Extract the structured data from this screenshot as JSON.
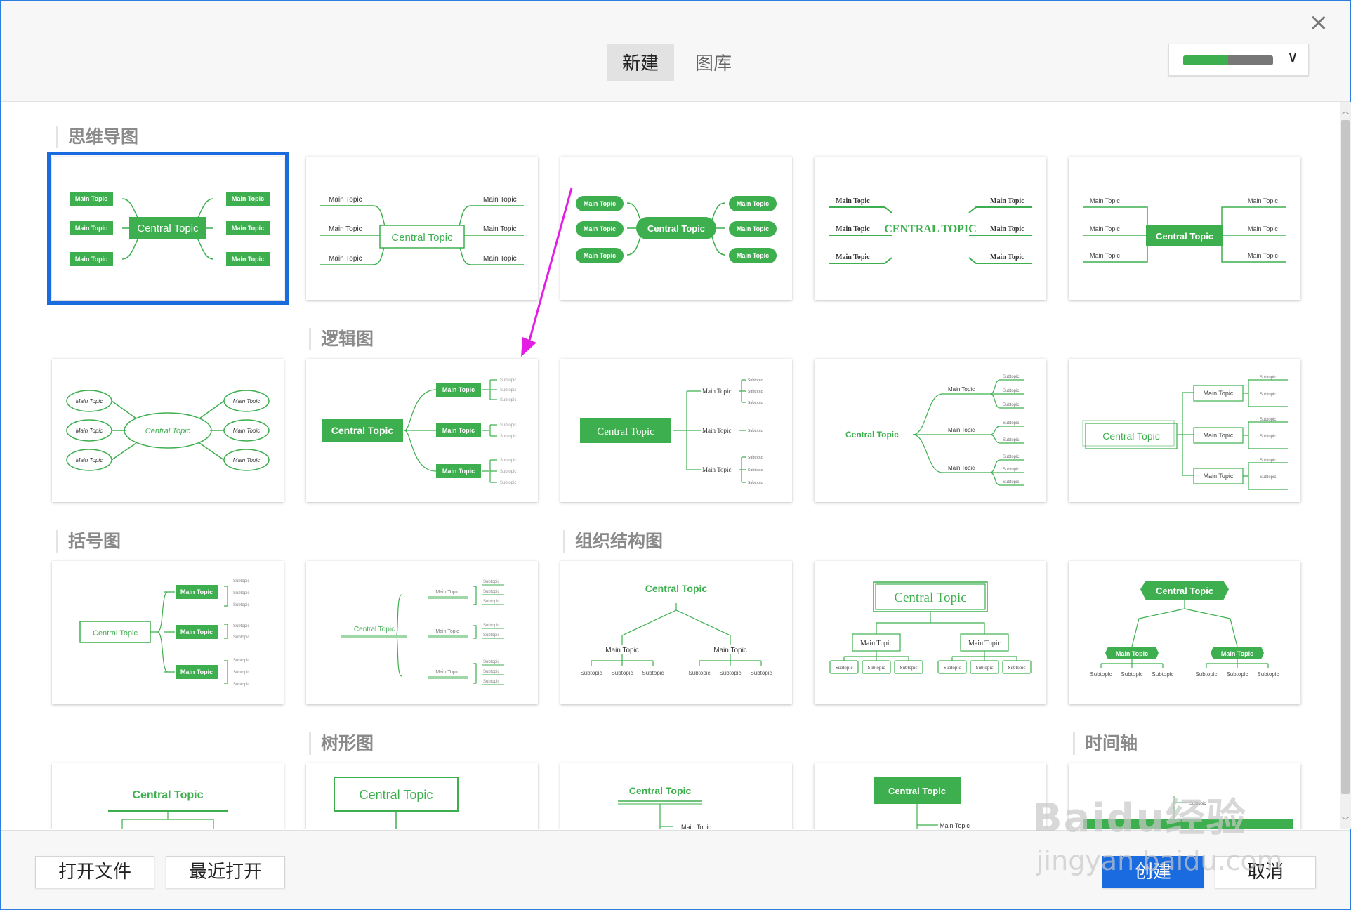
{
  "header": {
    "tabs": [
      {
        "label": "新建",
        "active": true
      },
      {
        "label": "图库",
        "active": false
      }
    ],
    "close_label": "×",
    "theme_chevron": "∨",
    "theme_colors": [
      "#3daf4e",
      "#777777"
    ]
  },
  "sections": {
    "mindmap": "思维导图",
    "logic": "逻辑图",
    "brace": "括号图",
    "org": "组织结构图",
    "tree": "树形图",
    "timeline": "时间轴"
  },
  "labels": {
    "central": "Central Topic",
    "central_caps": "CENTRAL TOPIC",
    "main": "Main Topic",
    "sub": "Subtopic"
  },
  "footer": {
    "open_file": "打开文件",
    "recent": "最近打开",
    "create": "创建",
    "cancel": "取消"
  },
  "watermark": {
    "line1": "Baidu经验",
    "line2": "jingyan.baidu.com"
  },
  "colors": {
    "accent": "#3daf4e",
    "primary": "#1a6be0",
    "annotation": "#e41de4"
  }
}
